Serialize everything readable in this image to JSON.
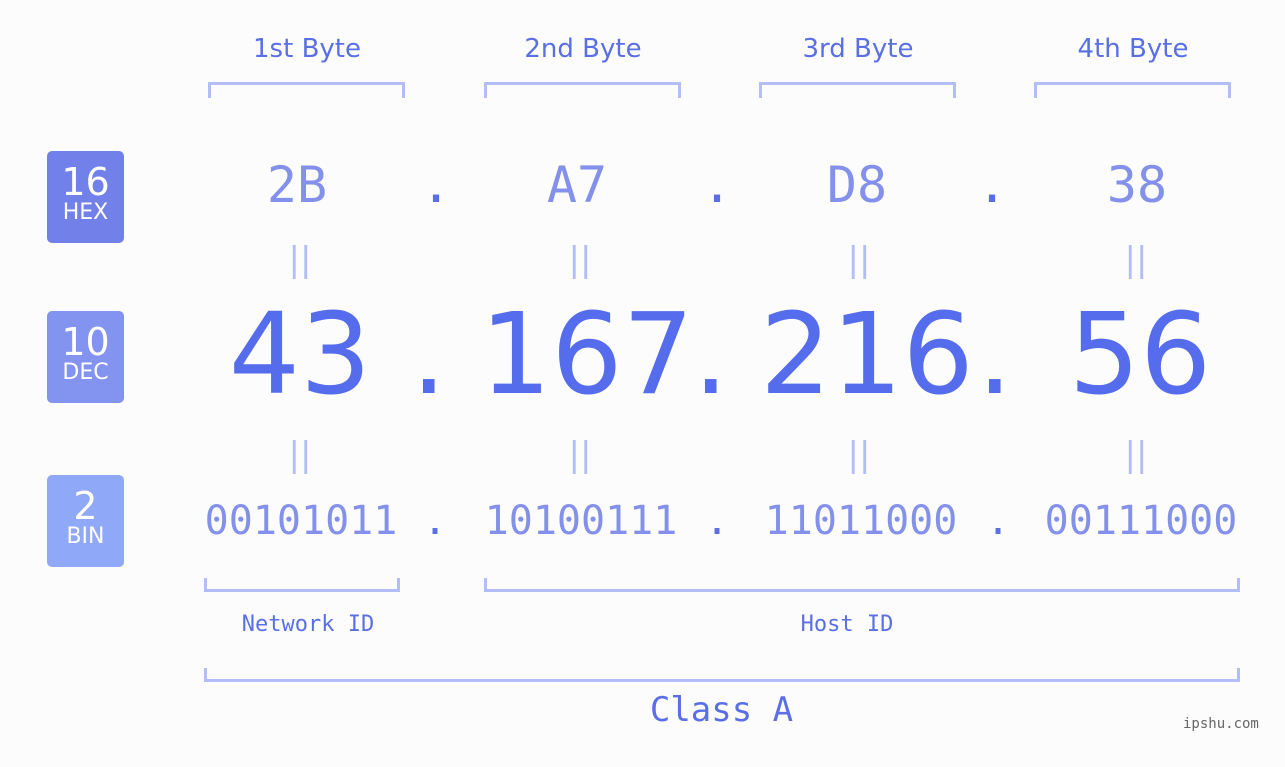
{
  "colors": {
    "hex_badge": "#7281ea",
    "dec_badge": "#8393f0",
    "bin_badge": "#8fa8f8",
    "accent": "#556ced",
    "muted": "#8391ec",
    "bracket": "#b3bdf6"
  },
  "bases": [
    {
      "number": "16",
      "label": "HEX"
    },
    {
      "number": "10",
      "label": "DEC"
    },
    {
      "number": "2",
      "label": "BIN"
    }
  ],
  "byte_labels": [
    "1st Byte",
    "2nd Byte",
    "3rd Byte",
    "4th Byte"
  ],
  "hex": [
    "2B",
    "A7",
    "D8",
    "38"
  ],
  "dec": [
    "43",
    "167",
    "216",
    "56"
  ],
  "bin": [
    "00101011",
    "10100111",
    "11011000",
    "00111000"
  ],
  "separator": ".",
  "equals": "||",
  "network_id_label": "Network ID",
  "host_id_label": "Host ID",
  "class_label": "Class A",
  "watermark": "ipshu.com"
}
